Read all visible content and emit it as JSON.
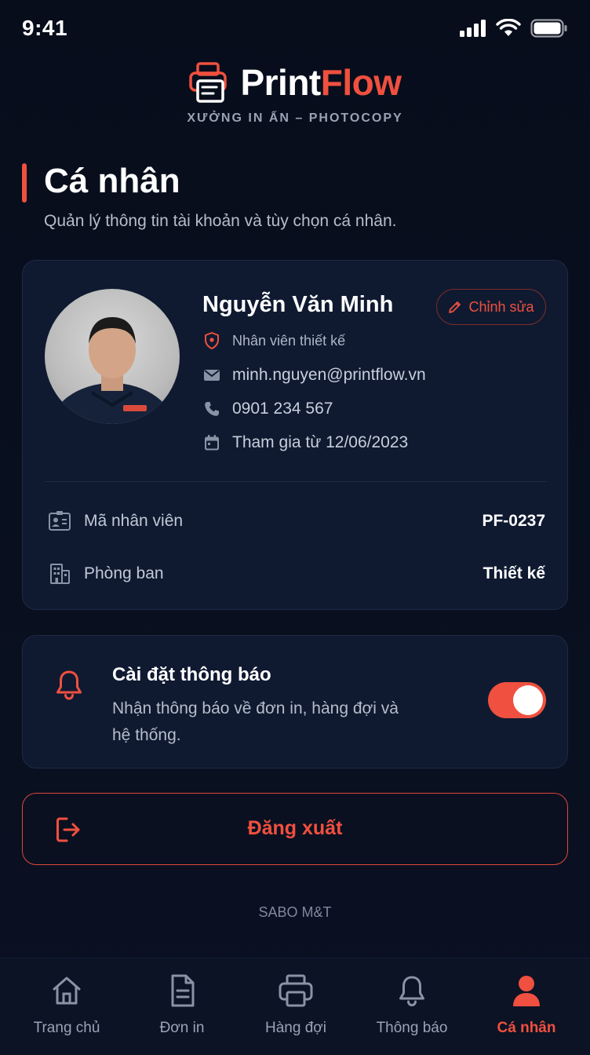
{
  "status_bar": {
    "time": "9:41"
  },
  "brand": {
    "name_part1": "Print",
    "name_part2": "Flow",
    "tagline": "XƯỞNG IN ẤN – PHOTOCOPY"
  },
  "page": {
    "title": "Cá nhân",
    "subtitle": "Quản lý thông tin tài khoản và tùy chọn cá nhân."
  },
  "profile": {
    "name": "Nguyễn Văn Minh",
    "edit_label": "Chỉnh sửa",
    "role": "Nhân viên thiết kế",
    "email": "minh.nguyen@printflow.vn",
    "phone": "0901 234 567",
    "joined": "Tham gia từ 12/06/2023",
    "details": [
      {
        "label": "Mã nhân viên",
        "value": "PF-0237",
        "icon": "id-card-icon"
      },
      {
        "label": "Phòng ban",
        "value": "Thiết kế",
        "icon": "building-icon"
      }
    ]
  },
  "notifications": {
    "title": "Cài đặt thông báo",
    "description": "Nhận thông báo về đơn in, hàng đợi và hệ thống.",
    "enabled": true
  },
  "logout": {
    "label": "Đăng xuất"
  },
  "footer": {
    "brand": "SABO M&T"
  },
  "nav": {
    "items": [
      {
        "label": "Trang chủ",
        "icon": "home-icon",
        "active": false
      },
      {
        "label": "Đơn in",
        "icon": "document-icon",
        "active": false
      },
      {
        "label": "Hàng đợi",
        "icon": "printer-icon",
        "active": false
      },
      {
        "label": "Thông báo",
        "icon": "bell-icon",
        "active": false
      },
      {
        "label": "Cá nhân",
        "icon": "user-icon",
        "active": true
      }
    ]
  },
  "colors": {
    "accent": "#f0503f",
    "background": "#070d1b",
    "card": "#0f1a31"
  }
}
